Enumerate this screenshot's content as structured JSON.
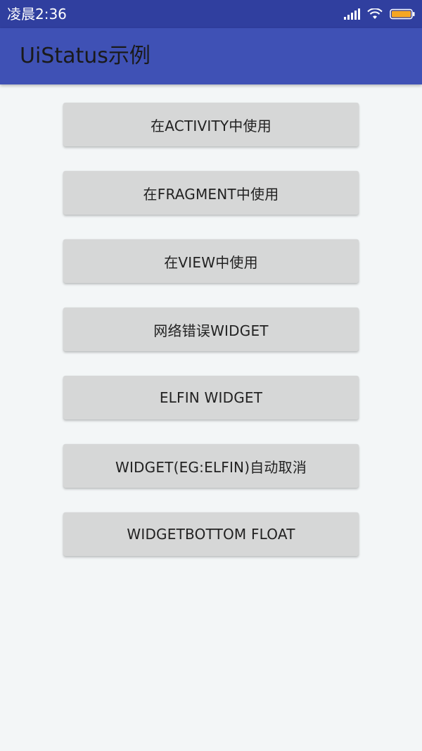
{
  "status_bar": {
    "time": "凌晨2:36",
    "icons": [
      "signal-icon",
      "wifi-icon",
      "battery-icon"
    ],
    "battery_color": "#f5a623"
  },
  "app_bar": {
    "title": "UiStatus示例",
    "color": "#3f51b5"
  },
  "buttons": [
    {
      "label": "在ACTIVITY中使用"
    },
    {
      "label": "在FRAGMENT中使用"
    },
    {
      "label": "在VIEW中使用"
    },
    {
      "label": "网络错误WIDGET"
    },
    {
      "label": "ELFIN WIDGET"
    },
    {
      "label": "WIDGET(EG:ELFIN)自动取消"
    },
    {
      "label": "WIDGETBOTTOM FLOAT"
    }
  ]
}
